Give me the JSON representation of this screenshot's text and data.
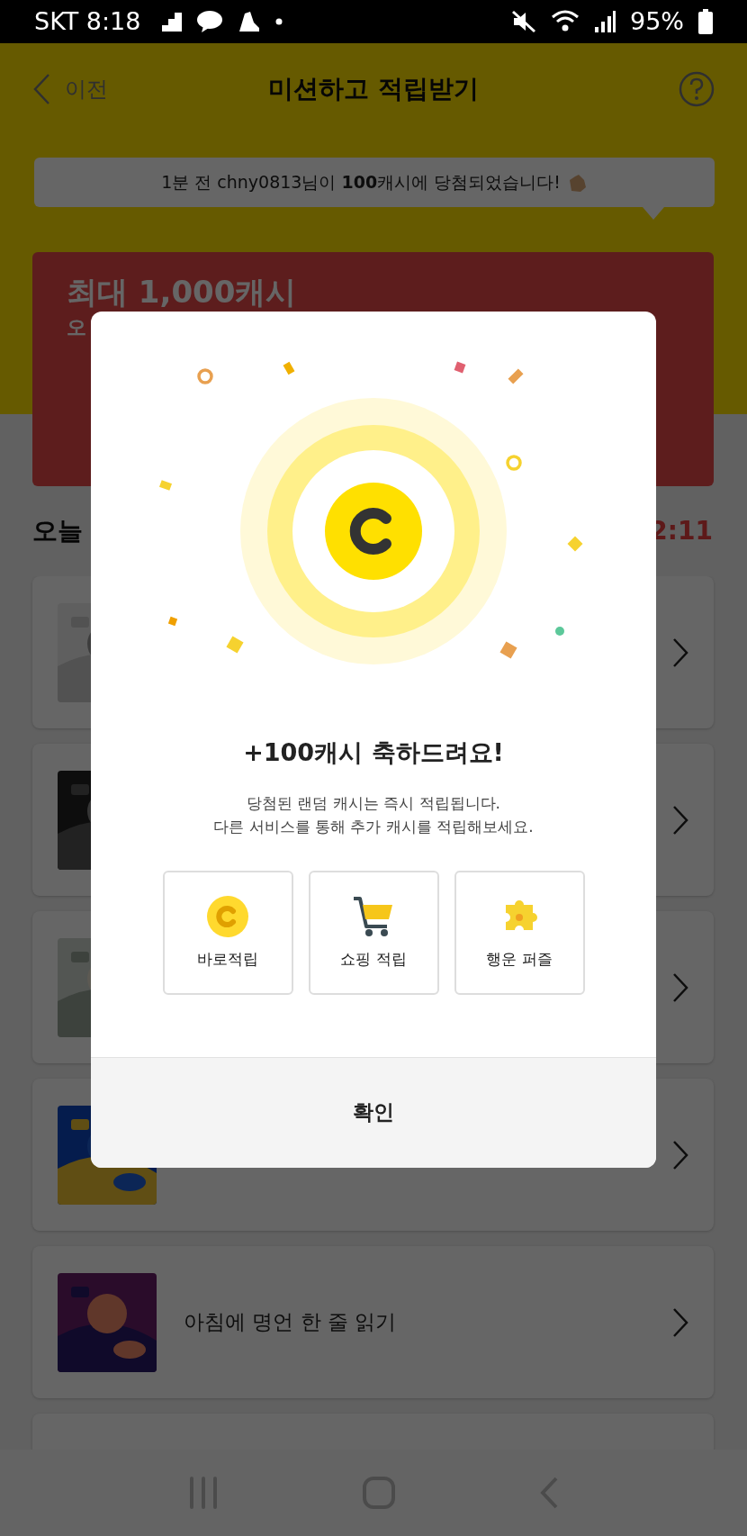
{
  "status_bar": {
    "carrier_time": "SKT 8:18",
    "battery": "95%"
  },
  "header": {
    "back_label": "이전",
    "title": "미션하고 적립받기"
  },
  "ticker": "1분 전 chny0813님이 **100**캐시에 당첨되었습니다!",
  "banner": {
    "title": "최대 1,000캐시",
    "subtitle": "오"
  },
  "section": {
    "title": "오늘",
    "timer": "2:11"
  },
  "missions": [
    {
      "kind": "picture"
    },
    {
      "kind": "picture"
    },
    {
      "kind": "picture"
    },
    {
      "kind": "picture"
    },
    {
      "kind": "picture",
      "label": "아침에 명언 한 줄 읽기"
    },
    {
      "kind": "blank"
    }
  ],
  "dialog": {
    "title": "+100캐시 축하드려요!",
    "description": [
      "당첨된 랜덤 캐시는 즉시 적립됩니다.",
      "다른 서비스를 통해 추가 캐시를 적립해보세요."
    ],
    "shortcuts": [
      {
        "kind": "coin",
        "label": "바로적립"
      },
      {
        "kind": "cart",
        "label": "쇼핑 적립"
      },
      {
        "kind": "puzzle",
        "label": "행운 퍼즐"
      }
    ],
    "confirm": "확인"
  }
}
